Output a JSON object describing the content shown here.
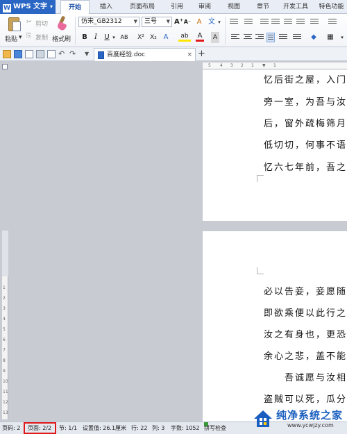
{
  "app": {
    "name": "WPS 文字"
  },
  "menu_tabs": [
    "开始",
    "插入",
    "页面布局",
    "引用",
    "审阅",
    "视图",
    "章节",
    "开发工具",
    "特色功能"
  ],
  "ribbon": {
    "paste": "粘贴",
    "cut": "剪切",
    "copy": "复制",
    "format_painter": "格式刷",
    "font_name": "仿宋_GB2312",
    "font_size": "三号",
    "bold": "B",
    "italic": "I",
    "underline": "U",
    "superscript": "X²",
    "subscript": "X₂",
    "grow_font": "A⁺",
    "shrink_font": "A⁻",
    "clear": "A",
    "phonetic": "文",
    "font_color": "A",
    "highlight": "ab"
  },
  "document": {
    "tab_name": "百度经验.doc",
    "page1_lines": [
      "忆后街之屋，入门",
      "旁一室，为吾与汝",
      "后，窗外疏梅筛月",
      "低切切，何事不语",
      "忆六七年前，吾之"
    ],
    "page2_lines": [
      "必以告妾，妾愿随",
      "即欲乘便以此行之",
      "汝之有身也，更恐",
      "余心之悲，盖不能",
      "吾诚愿与汝相",
      "盗贼可以死，瓜分"
    ]
  },
  "ruler": {
    "h_ticks": [
      "5",
      "4",
      "3",
      "2",
      "1",
      "",
      "1"
    ],
    "v_ticks": [
      "4",
      "3",
      "2",
      "1",
      "",
      "1",
      "2",
      "3",
      "4",
      "5",
      "6",
      "7",
      "8",
      "9",
      "10",
      "11",
      "12",
      "13"
    ]
  },
  "status_bar": {
    "page_code": "页码: 2",
    "page": "页面: 2/2",
    "section": "节: 1/1",
    "setting": "设置值: 26.1厘米",
    "row": "行: 22",
    "col": "列: 3",
    "words": "字数: 1052",
    "spell": "拼写检查"
  },
  "watermark": {
    "title": "纯净系统之家",
    "url": "www.ycwjzy.com"
  },
  "colors": {
    "accent": "#2a66c4",
    "highlight_box": "#e01818"
  }
}
